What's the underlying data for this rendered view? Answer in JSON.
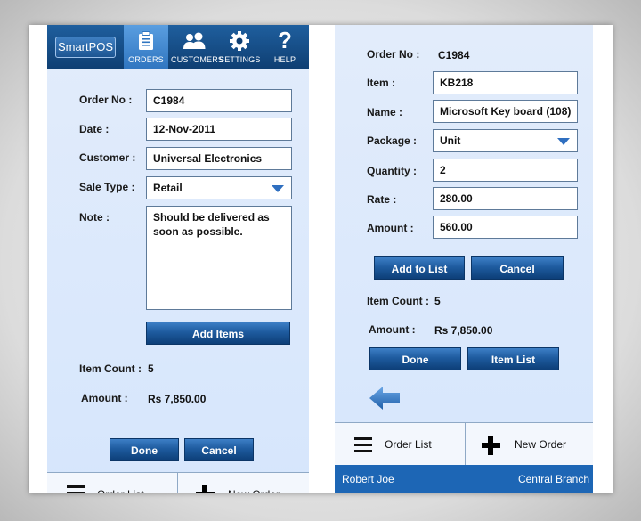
{
  "app": {
    "logo": "SmartPOS"
  },
  "nav": {
    "orders": "ORDERS",
    "customers": "CUSTOMERS",
    "settings": "SETTINGS",
    "help": "HELP",
    "active": "orders"
  },
  "order_form": {
    "order_no_label": "Order No :",
    "order_no": "C1984",
    "date_label": "Date :",
    "date": "12-Nov-2011",
    "customer_label": "Customer  :",
    "customer": "Universal Electronics",
    "sale_type_label": "Sale Type :",
    "sale_type": "Retail",
    "note_label": "Note :",
    "note": "Should be delivered as soon as possible.",
    "add_items": "Add Items",
    "item_count_label": "Item Count :",
    "item_count": "5",
    "amount_label": "Amount  :",
    "amount": "Rs 7,850.00",
    "done": "Done",
    "cancel": "Cancel"
  },
  "item_form": {
    "order_no_label": "Order No :",
    "order_no": "C1984",
    "item_label": "Item :",
    "item": "KB218",
    "name_label": "Name :",
    "name": "Microsoft Key board (108)",
    "package_label": "Package :",
    "package": "Unit",
    "quantity_label": "Quantity :",
    "quantity": "2",
    "rate_label": "Rate :",
    "rate": "280.00",
    "amount_label": "Amount :",
    "amount": "560.00",
    "add_to_list": "Add to List",
    "cancel": "Cancel",
    "item_count_label": "Item Count :",
    "item_count": "5",
    "total_label": "Amount  :",
    "total": "Rs 7,850.00",
    "done": "Done",
    "item_list": "Item List"
  },
  "bottom_bar": {
    "order_list": "Order List",
    "new_order": "New Order"
  },
  "status": {
    "user": "Robert Joe",
    "branch": "Central  Branch"
  },
  "colors": {
    "accent": "#1d66b5",
    "nav_bg": "#0e3e72",
    "panel_bg": "#d6e6fc"
  }
}
